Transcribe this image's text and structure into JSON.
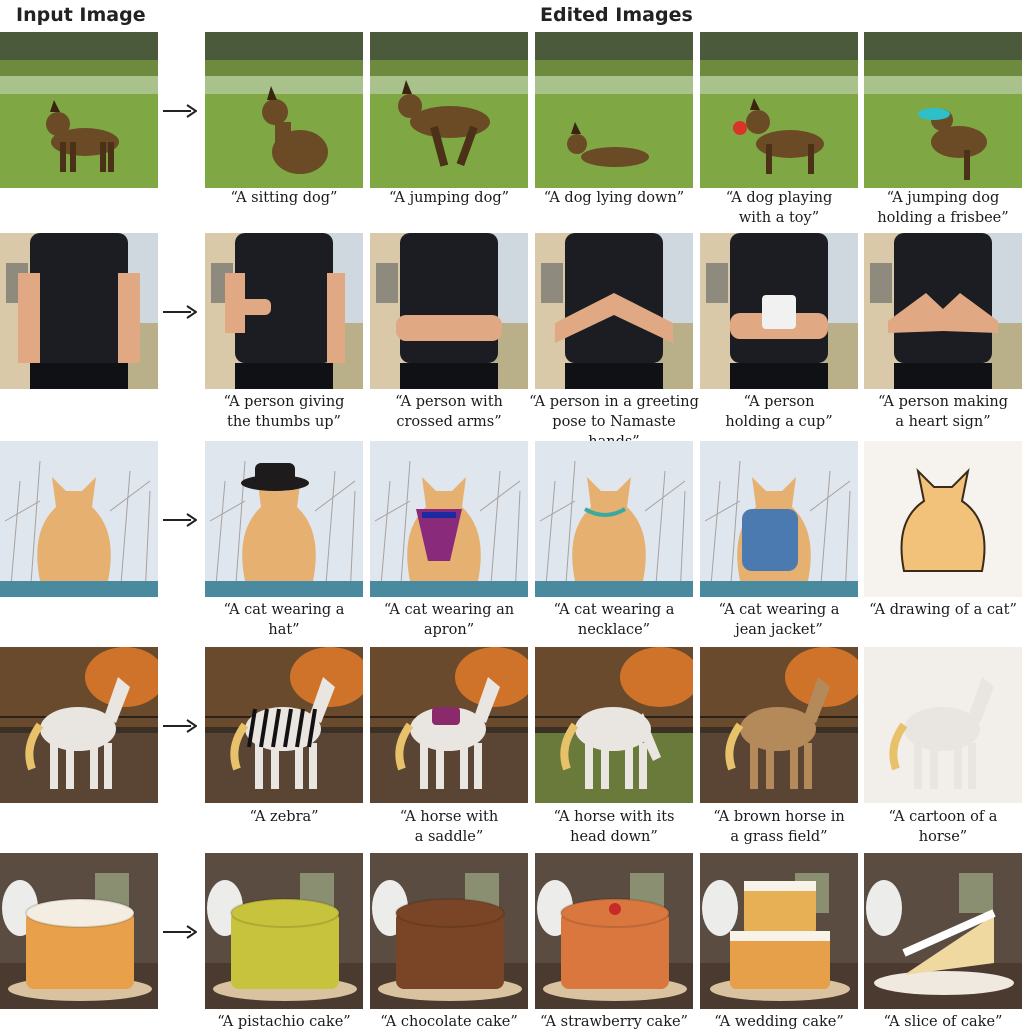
{
  "headers": {
    "input": "Input Image",
    "edited": "Edited Images"
  },
  "rows": [
    {
      "subject": "dog",
      "captions": [
        "“A sitting dog”",
        "“A jumping dog”",
        "“A dog lying down”",
        "“A dog playing\nwith a toy”",
        "“A jumping dog\nholding a frisbee”"
      ]
    },
    {
      "subject": "person",
      "captions": [
        "“A person giving\nthe thumbs up”",
        "“A person with\ncrossed arms”",
        "“A person in a greeting\npose to Namaste hands”",
        "“A person\nholding a cup”",
        "“A person making\na heart sign”"
      ]
    },
    {
      "subject": "cat",
      "captions": [
        "“A cat wearing a\nhat”",
        "“A cat wearing an\napron”",
        "“A cat wearing a\nnecklace”",
        "“A cat wearing a\njean jacket”",
        "“A drawing of a cat”"
      ]
    },
    {
      "subject": "horse",
      "captions": [
        "“A zebra”",
        "“A horse with\na saddle”",
        "“A horse with its\nhead down”",
        "“A brown horse in\na grass field”",
        "“A cartoon of a\nhorse”"
      ]
    },
    {
      "subject": "cake",
      "captions": [
        "“A pistachio cake”",
        "“A chocolate cake”",
        "“A strawberry cake”",
        "“A wedding cake”",
        "“A slice of cake”"
      ]
    }
  ],
  "colors": {
    "grass": "#7fa845",
    "dog": "#6b4a26",
    "shirt": "#1b1d22",
    "skin": "#e0a983",
    "cat": "#e6b070",
    "snow": "#dfe6ee",
    "horse": "#e9e6e2",
    "ground": "#5a4534",
    "cake_plain": "#e8a14a",
    "pistachio": "#c7c33d",
    "chocolate": "#7a4526",
    "strawberry": "#d9773f",
    "wedding": "#f1d8a8",
    "table": "#4a3a30"
  }
}
